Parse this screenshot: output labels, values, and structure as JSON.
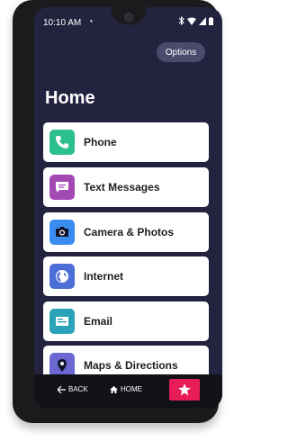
{
  "status": {
    "time": "10:10 AM",
    "dot": "•"
  },
  "header": {
    "options_label": "Options",
    "title": "Home"
  },
  "items": [
    {
      "label": "Phone",
      "icon": "phone-icon",
      "color": "#2bbf8f"
    },
    {
      "label": "Text Messages",
      "icon": "message-icon",
      "color": "#a249b3"
    },
    {
      "label": "Camera & Photos",
      "icon": "camera-icon",
      "color": "#3a8df0"
    },
    {
      "label": "Internet",
      "icon": "globe-icon",
      "color": "#4b6fd6"
    },
    {
      "label": "Email",
      "icon": "email-icon",
      "color": "#2aa3b8"
    },
    {
      "label": "Maps & Directions",
      "icon": "map-pin-icon",
      "color": "#6b68d1"
    }
  ],
  "nav": {
    "back_label": "BACK",
    "home_label": "HOME",
    "star_color": "#e81c57"
  }
}
